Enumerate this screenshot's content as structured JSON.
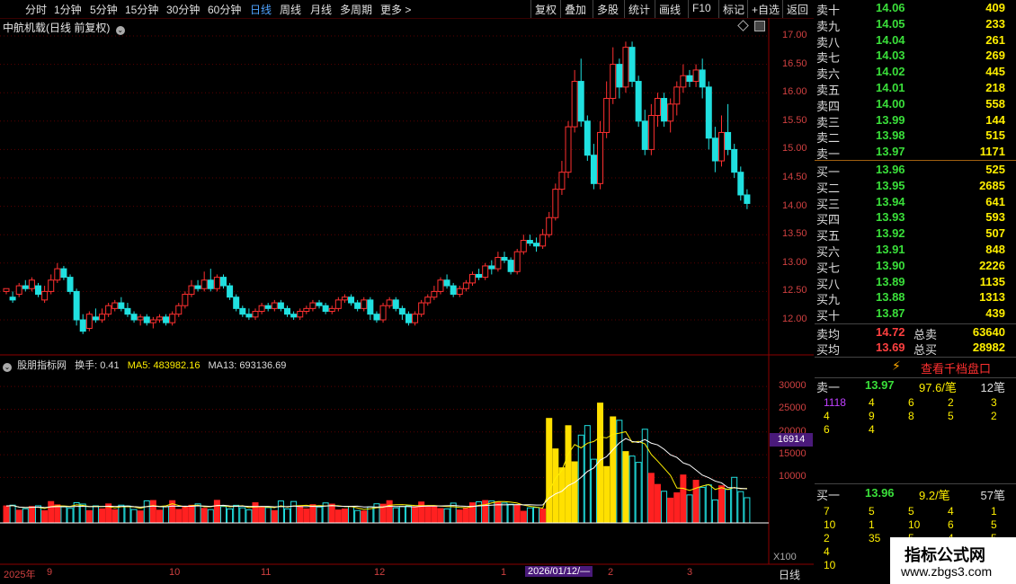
{
  "toolbar": {
    "periods": [
      "分时",
      "1分钟",
      "5分钟",
      "15分钟",
      "30分钟",
      "60分钟",
      "日线",
      "周线",
      "月线",
      "多周期",
      "更多 >"
    ],
    "active": "日线",
    "tools": [
      "复权",
      "叠加",
      "多股",
      "统计",
      "画线",
      "F10",
      "标记",
      "+自选",
      "返回"
    ]
  },
  "title": "中航机载(日线 前复权)",
  "price_axis": [
    "17.00",
    "16.50",
    "16.00",
    "15.50",
    "15.00",
    "14.50",
    "14.00",
    "13.50",
    "13.00",
    "12.50",
    "12.00"
  ],
  "vol_axis": [
    "30000",
    "25000",
    "20000",
    "15000",
    "10000"
  ],
  "vol_hl": "16914",
  "vol_unit": "X100",
  "indicator": {
    "name": "股朋指标网",
    "turn": "换手: 0.41",
    "ma5": "MA5: 483982.16",
    "ma13": "MA13: 693136.69"
  },
  "xaxis": {
    "labels": [
      "2025年",
      "9",
      "10",
      "11",
      "12",
      "1",
      "2",
      "3"
    ],
    "cursor": "2026/01/12/—",
    "period": "日线"
  },
  "orderbook": {
    "asks": [
      [
        "卖十",
        "14.06",
        "409"
      ],
      [
        "卖九",
        "14.05",
        "233"
      ],
      [
        "卖八",
        "14.04",
        "261"
      ],
      [
        "卖七",
        "14.03",
        "269"
      ],
      [
        "卖六",
        "14.02",
        "445"
      ],
      [
        "卖五",
        "14.01",
        "218"
      ],
      [
        "卖四",
        "14.00",
        "558"
      ],
      [
        "卖三",
        "13.99",
        "144"
      ],
      [
        "卖二",
        "13.98",
        "515"
      ],
      [
        "卖一",
        "13.97",
        "1171"
      ]
    ],
    "bids": [
      [
        "买一",
        "13.96",
        "525"
      ],
      [
        "买二",
        "13.95",
        "2685"
      ],
      [
        "买三",
        "13.94",
        "641"
      ],
      [
        "买四",
        "13.93",
        "593"
      ],
      [
        "买五",
        "13.92",
        "507"
      ],
      [
        "买六",
        "13.91",
        "848"
      ],
      [
        "买七",
        "13.90",
        "2226"
      ],
      [
        "买八",
        "13.89",
        "1135"
      ],
      [
        "买九",
        "13.88",
        "1313"
      ],
      [
        "买十",
        "13.87",
        "439"
      ]
    ],
    "avg_sell": [
      "卖均",
      "14.72",
      "总卖",
      "63640"
    ],
    "avg_buy": [
      "买均",
      "13.69",
      "总买",
      "28982"
    ],
    "qiandang": "查看千档盘口",
    "s1": [
      "卖一",
      "13.97",
      "97.6/笔",
      "12笔"
    ],
    "s1_grid": [
      [
        "1118",
        "4",
        "6",
        "2",
        "3"
      ],
      [
        "4",
        "9",
        "8",
        "5",
        "2"
      ],
      [
        "6",
        "4",
        "",
        "",
        ""
      ]
    ],
    "b1": [
      "买一",
      "13.96",
      "9.2/笔",
      "57笔"
    ],
    "b1_grid": [
      [
        "7",
        "5",
        "5",
        "4",
        "1"
      ],
      [
        "10",
        "1",
        "10",
        "6",
        "5"
      ],
      [
        "2",
        "35",
        "5",
        "4",
        "5"
      ],
      [
        "4",
        "",
        "",
        "",
        ""
      ],
      [
        "10",
        "",
        "",
        "",
        ""
      ]
    ]
  },
  "watermark": {
    "title": "指标公式网",
    "url": "www.zbgs3.com"
  },
  "chart_data": {
    "type": "candlestick",
    "price_range": [
      11.8,
      17.2
    ],
    "candles": [
      [
        12.5,
        12.55,
        12.5,
        12.45
      ],
      [
        12.4,
        12.35,
        12.5,
        12.3
      ],
      [
        12.45,
        12.6,
        12.65,
        12.4
      ],
      [
        12.6,
        12.55,
        12.7,
        12.5
      ],
      [
        12.55,
        12.7,
        12.75,
        12.5
      ],
      [
        12.6,
        12.45,
        12.65,
        12.4
      ],
      [
        12.35,
        12.5,
        12.6,
        12.3
      ],
      [
        12.5,
        12.7,
        12.8,
        12.45
      ],
      [
        12.7,
        12.9,
        13.0,
        12.65
      ],
      [
        12.9,
        12.75,
        12.95,
        12.7
      ],
      [
        12.75,
        12.5,
        12.8,
        12.45
      ],
      [
        12.5,
        12.0,
        12.55,
        11.9
      ],
      [
        12.0,
        11.8,
        12.1,
        11.75
      ],
      [
        11.85,
        12.1,
        12.15,
        11.8
      ],
      [
        12.05,
        12.0,
        12.2,
        11.95
      ],
      [
        12.0,
        12.1,
        12.2,
        11.95
      ],
      [
        12.1,
        12.25,
        12.3,
        12.05
      ],
      [
        12.2,
        12.3,
        12.35,
        12.15
      ],
      [
        12.3,
        12.2,
        12.4,
        12.15
      ],
      [
        12.2,
        12.1,
        12.3,
        12.05
      ],
      [
        12.1,
        12.0,
        12.15,
        11.95
      ],
      [
        12.0,
        12.05,
        12.1,
        11.9
      ],
      [
        12.05,
        11.95,
        12.1,
        11.9
      ],
      [
        11.95,
        12.0,
        12.05,
        11.85
      ],
      [
        12.0,
        12.05,
        12.1,
        11.95
      ],
      [
        12.05,
        11.95,
        12.1,
        11.9
      ],
      [
        11.95,
        12.1,
        12.15,
        11.9
      ],
      [
        12.1,
        12.25,
        12.3,
        12.05
      ],
      [
        12.25,
        12.45,
        12.5,
        12.2
      ],
      [
        12.45,
        12.6,
        12.7,
        12.4
      ],
      [
        12.6,
        12.55,
        12.7,
        12.5
      ],
      [
        12.55,
        12.7,
        12.85,
        12.5
      ],
      [
        12.7,
        12.55,
        12.9,
        12.5
      ],
      [
        12.55,
        12.75,
        12.8,
        12.5
      ],
      [
        12.75,
        12.6,
        12.8,
        12.55
      ],
      [
        12.6,
        12.4,
        12.65,
        12.35
      ],
      [
        12.4,
        12.2,
        12.45,
        12.15
      ],
      [
        12.2,
        12.1,
        12.25,
        12.05
      ],
      [
        12.1,
        12.05,
        12.2,
        12.0
      ],
      [
        12.05,
        12.15,
        12.2,
        12.0
      ],
      [
        12.15,
        12.25,
        12.3,
        12.1
      ],
      [
        12.25,
        12.2,
        12.3,
        12.15
      ],
      [
        12.2,
        12.3,
        12.35,
        12.15
      ],
      [
        12.3,
        12.2,
        12.35,
        12.15
      ],
      [
        12.2,
        12.1,
        12.25,
        12.05
      ],
      [
        12.1,
        12.05,
        12.15,
        12.0
      ],
      [
        12.05,
        12.15,
        12.2,
        12.0
      ],
      [
        12.15,
        12.2,
        12.25,
        12.1
      ],
      [
        12.2,
        12.3,
        12.35,
        12.15
      ],
      [
        12.3,
        12.25,
        12.35,
        12.2
      ],
      [
        12.25,
        12.15,
        12.3,
        12.1
      ],
      [
        12.15,
        12.2,
        12.25,
        12.1
      ],
      [
        12.2,
        12.35,
        12.4,
        12.15
      ],
      [
        12.35,
        12.4,
        12.45,
        12.3
      ],
      [
        12.4,
        12.3,
        12.45,
        12.25
      ],
      [
        12.3,
        12.2,
        12.35,
        12.15
      ],
      [
        12.2,
        12.35,
        12.4,
        12.15
      ],
      [
        12.35,
        12.1,
        12.4,
        12.0
      ],
      [
        12.1,
        12.0,
        12.15,
        11.95
      ],
      [
        12.0,
        12.25,
        12.3,
        11.95
      ],
      [
        12.25,
        12.35,
        12.4,
        12.2
      ],
      [
        12.35,
        12.2,
        12.4,
        12.15
      ],
      [
        12.2,
        12.1,
        12.25,
        12.0
      ],
      [
        12.1,
        11.95,
        12.15,
        11.9
      ],
      [
        11.95,
        12.1,
        12.15,
        11.9
      ],
      [
        12.1,
        12.3,
        12.35,
        12.05
      ],
      [
        12.3,
        12.4,
        12.45,
        12.25
      ],
      [
        12.4,
        12.5,
        12.6,
        12.35
      ],
      [
        12.5,
        12.7,
        12.75,
        12.45
      ],
      [
        12.7,
        12.6,
        12.8,
        12.55
      ],
      [
        12.6,
        12.45,
        12.65,
        12.4
      ],
      [
        12.45,
        12.55,
        12.6,
        12.4
      ],
      [
        12.55,
        12.65,
        12.7,
        12.5
      ],
      [
        12.65,
        12.8,
        12.85,
        12.6
      ],
      [
        12.8,
        12.75,
        12.9,
        12.7
      ],
      [
        12.75,
        12.95,
        13.0,
        12.7
      ],
      [
        12.95,
        12.9,
        13.05,
        12.8
      ],
      [
        12.9,
        13.1,
        13.2,
        12.85
      ],
      [
        13.1,
        13.05,
        13.2,
        13.0
      ],
      [
        13.05,
        12.85,
        13.1,
        12.8
      ],
      [
        12.85,
        13.2,
        13.25,
        12.8
      ],
      [
        13.2,
        13.4,
        13.5,
        13.15
      ],
      [
        13.4,
        13.35,
        13.5,
        13.3
      ],
      [
        13.35,
        13.3,
        13.45,
        13.2
      ],
      [
        13.3,
        13.5,
        13.6,
        13.25
      ],
      [
        13.5,
        13.8,
        13.9,
        13.45
      ],
      [
        13.8,
        14.3,
        14.4,
        13.75
      ],
      [
        14.3,
        14.6,
        14.8,
        14.2
      ],
      [
        14.6,
        15.4,
        15.5,
        14.5
      ],
      [
        15.4,
        16.2,
        16.4,
        15.3
      ],
      [
        16.2,
        15.5,
        16.6,
        15.4
      ],
      [
        15.5,
        14.9,
        15.6,
        14.8
      ],
      [
        14.9,
        14.4,
        15.1,
        14.3
      ],
      [
        14.4,
        15.3,
        15.5,
        14.3
      ],
      [
        15.3,
        15.9,
        16.2,
        15.2
      ],
      [
        15.9,
        16.5,
        16.8,
        15.8
      ],
      [
        16.5,
        16.1,
        16.6,
        15.9
      ],
      [
        16.1,
        16.8,
        16.9,
        16.0
      ],
      [
        16.8,
        16.2,
        16.9,
        16.1
      ],
      [
        16.2,
        15.5,
        16.3,
        15.4
      ],
      [
        15.5,
        15.0,
        15.7,
        14.9
      ],
      [
        15.0,
        15.6,
        15.8,
        14.9
      ],
      [
        15.6,
        15.9,
        16.0,
        15.4
      ],
      [
        15.9,
        15.5,
        16.0,
        15.4
      ],
      [
        15.5,
        15.8,
        15.9,
        15.3
      ],
      [
        15.8,
        16.1,
        16.2,
        15.6
      ],
      [
        16.1,
        16.3,
        16.5,
        16.0
      ],
      [
        16.3,
        16.2,
        16.4,
        16.1
      ],
      [
        16.2,
        16.4,
        16.5,
        16.1
      ],
      [
        16.4,
        16.1,
        16.6,
        15.9
      ],
      [
        16.1,
        15.2,
        16.2,
        15.0
      ],
      [
        15.2,
        14.8,
        15.4,
        14.6
      ],
      [
        14.8,
        15.3,
        15.6,
        14.7
      ],
      [
        15.3,
        15.0,
        15.8,
        14.9
      ],
      [
        15.0,
        14.6,
        15.1,
        14.5
      ],
      [
        14.6,
        14.2,
        14.7,
        14.1
      ],
      [
        14.2,
        14.05,
        14.3,
        13.95
      ]
    ],
    "volume_bars": "daily volume histogram (x100 shares) with MA5/MA13 lines"
  }
}
